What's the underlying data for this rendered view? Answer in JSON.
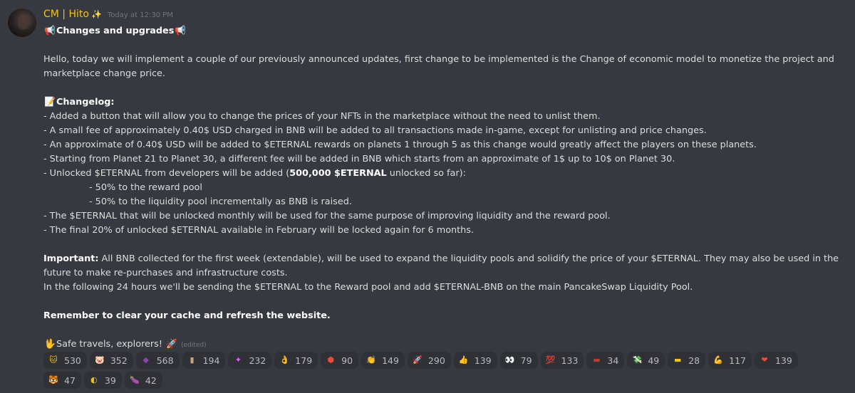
{
  "message": {
    "author": "CM | Hito",
    "author_badge": "✨",
    "timestamp": "Today at 12:30 PM",
    "title": "Changes and upgrades",
    "intro": "Hello, today we will implement a couple of our previously announced updates, first change to be implemented is the Change of economic model to monetize the project and marketplace change price.",
    "changelog_title": "Changelog:",
    "changelog": [
      "- Added a button that will allow you to change the prices of your NFTs in the marketplace without the need to unlist them.",
      "- A small fee of approximately 0.40$ USD charged in BNB will be added to all transactions made in-game, except for unlisting and price changes.",
      "- An approximate of 0.40$ USD will be added to $ETERNAL rewards on planets 1 through 5 as this change would greatly affect the players on these planets.",
      "- Starting from Planet 21 to Planet 30, a different fee will be added in BNB which starts from an approximate of 1$ up to 10$ on Planet 30."
    ],
    "unlock_prefix": "- Unlocked $ETERNAL from developers will be added (",
    "unlock_bold": "500,000 $ETERNAL",
    "unlock_suffix": " unlocked so far):",
    "sub_items": [
      "- 50% to the reward pool",
      "- 50% to the liquidity pool incrementally as BNB is raised."
    ],
    "changelog_more": [
      "- The $ETERNAL that will be unlocked monthly will be used for the same purpose of improving liquidity and the reward pool.",
      "- The final 20% of unlocked $ETERNAL available in February will be locked again for 6 months."
    ],
    "important_label": "Important:",
    "important_text": " All BNB collected for the first week (extendable), will be used to expand the liquidity pools and solidify the price of your $ETERNAL. They may also be used in the future to make re-purchases and infrastructure costs.",
    "following": "In the following 24 hours we'll be sending the $ETERNAL to the Reward pool and add $ETERNAL-BNB on the main PancakeSwap Liquidity Pool.",
    "reminder": "Remember to clear your cache and refresh the website.",
    "signoff": "Safe travels, explorers!",
    "edited": "(edited)"
  },
  "reactions": [
    {
      "icon": "cat-icon",
      "glyph": "🐱",
      "color": "#f1c40f",
      "count": "530"
    },
    {
      "icon": "pig-icon",
      "glyph": "🐷",
      "color": "#f4a6b8",
      "count": "352"
    },
    {
      "icon": "crystal-icon",
      "glyph": "◆",
      "color": "#8e44ad",
      "count": "568"
    },
    {
      "icon": "scroll-icon",
      "glyph": "▮",
      "color": "#c8a27c",
      "count": "194"
    },
    {
      "icon": "planet-icon",
      "glyph": "✦",
      "color": "#e066ff",
      "count": "232"
    },
    {
      "icon": "ok-hand-icon",
      "glyph": "👌",
      "color": "#f5c542",
      "count": "179"
    },
    {
      "icon": "shield-emblem-icon",
      "glyph": "⬢",
      "color": "#e74c3c",
      "count": "90"
    },
    {
      "icon": "clap-icon",
      "glyph": "👏",
      "color": "#f5c542",
      "count": "149"
    },
    {
      "icon": "rocket-icon",
      "glyph": "🚀",
      "color": "#5865f2",
      "count": "290"
    },
    {
      "icon": "thumbs-up-icon",
      "glyph": "👍",
      "color": "#f5c542",
      "count": "139"
    },
    {
      "icon": "eyes-icon",
      "glyph": "👀",
      "color": "#ffffff",
      "count": "79"
    },
    {
      "icon": "hundred-icon",
      "glyph": "💯",
      "color": "#e74c3c",
      "count": "133"
    },
    {
      "icon": "flag-costa-rica-icon",
      "glyph": "▬",
      "color": "#c0392b",
      "count": "34"
    },
    {
      "icon": "money-wings-icon",
      "glyph": "💸",
      "color": "#2ecc71",
      "count": "49"
    },
    {
      "icon": "flag-ecuador-icon",
      "glyph": "▬",
      "color": "#f1c40f",
      "count": "28"
    },
    {
      "icon": "muscle-icon",
      "glyph": "💪",
      "color": "#f5c542",
      "count": "117"
    },
    {
      "icon": "heart-icon",
      "glyph": "❤",
      "color": "#e74c3c",
      "count": "139"
    },
    {
      "icon": "tiger-icon",
      "glyph": "🐯",
      "color": "#f39c12",
      "count": "47"
    },
    {
      "icon": "coin-icon",
      "glyph": "◐",
      "color": "#f1c40f",
      "count": "39"
    },
    {
      "icon": "eggplant-icon",
      "glyph": "🍆",
      "color": "#8e44ad",
      "count": "42"
    }
  ]
}
